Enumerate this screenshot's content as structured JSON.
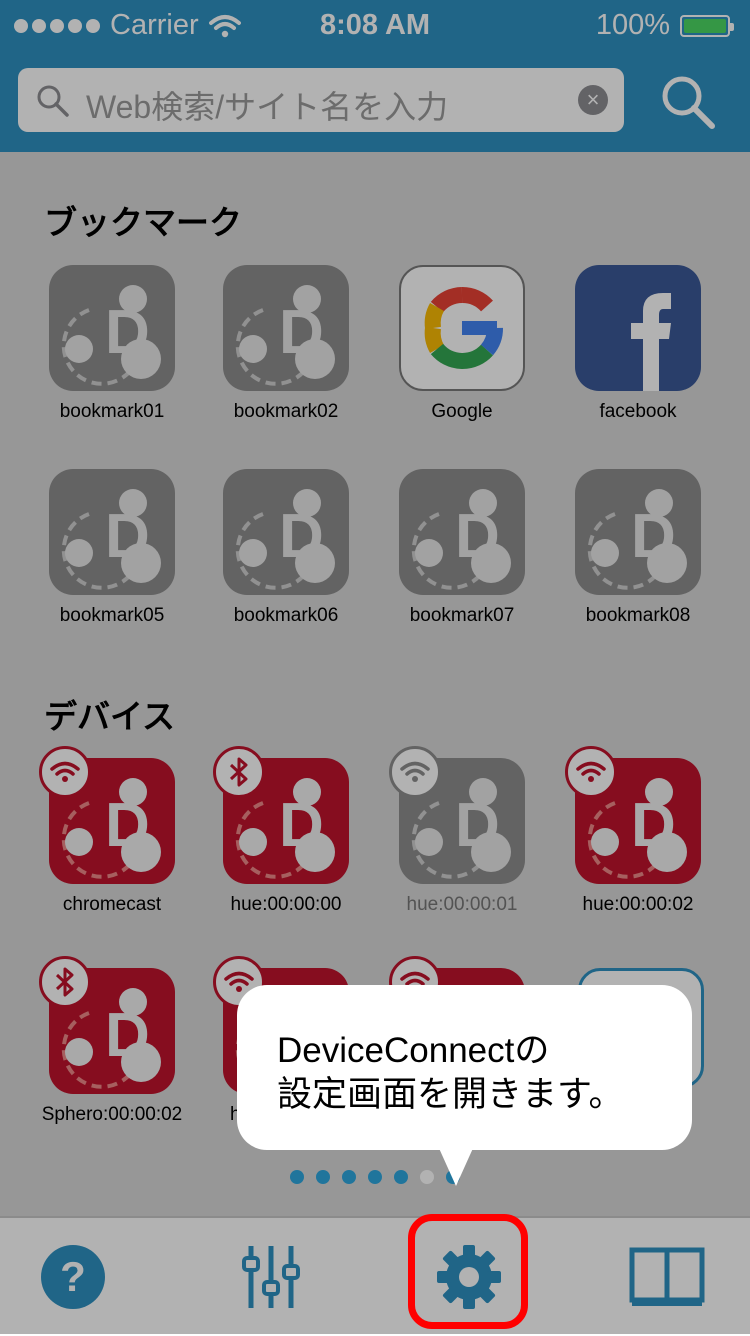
{
  "status_bar": {
    "carrier": "Carrier",
    "time": "8:08 AM",
    "battery": "100%"
  },
  "search": {
    "placeholder": "Web検索/サイト名を入力"
  },
  "bookmarks": {
    "title": "ブックマーク",
    "items": [
      {
        "label": "bookmark01"
      },
      {
        "label": "bookmark02"
      },
      {
        "label": "Google"
      },
      {
        "label": "facebook"
      },
      {
        "label": "bookmark05"
      },
      {
        "label": "bookmark06"
      },
      {
        "label": "bookmark07"
      },
      {
        "label": "bookmark08"
      }
    ]
  },
  "devices": {
    "title": "デバイス",
    "items": [
      {
        "label": "chromecast",
        "badge": "wifi-icon"
      },
      {
        "label": "hue:00:00:00",
        "badge": "bluetooth-icon"
      },
      {
        "label": "hue:00:00:01",
        "badge": "wifi-icon"
      },
      {
        "label": "hue:00:00:02",
        "badge": "wifi-icon"
      },
      {
        "label": "Sphero:00:00:02",
        "badge": "bluetooth-icon"
      },
      {
        "label": "h",
        "badge": "wifi-icon"
      },
      {
        "label": "",
        "badge": "wifi-icon"
      }
    ]
  },
  "callout": {
    "line1": "DeviceConnectの",
    "line2": "設定画面を開きます。"
  },
  "pager": {
    "count": 7,
    "current": 6
  },
  "tabs": [
    {
      "name": "help",
      "icon": "help-icon"
    },
    {
      "name": "settings-sliders",
      "icon": "sliders-icon"
    },
    {
      "name": "device-settings",
      "icon": "gear-icon"
    },
    {
      "name": "bookmarks",
      "icon": "book-icon"
    }
  ],
  "colors": {
    "accent": "#2f91c2",
    "device_red": "#c0142d",
    "highlight": "#ff0000"
  }
}
